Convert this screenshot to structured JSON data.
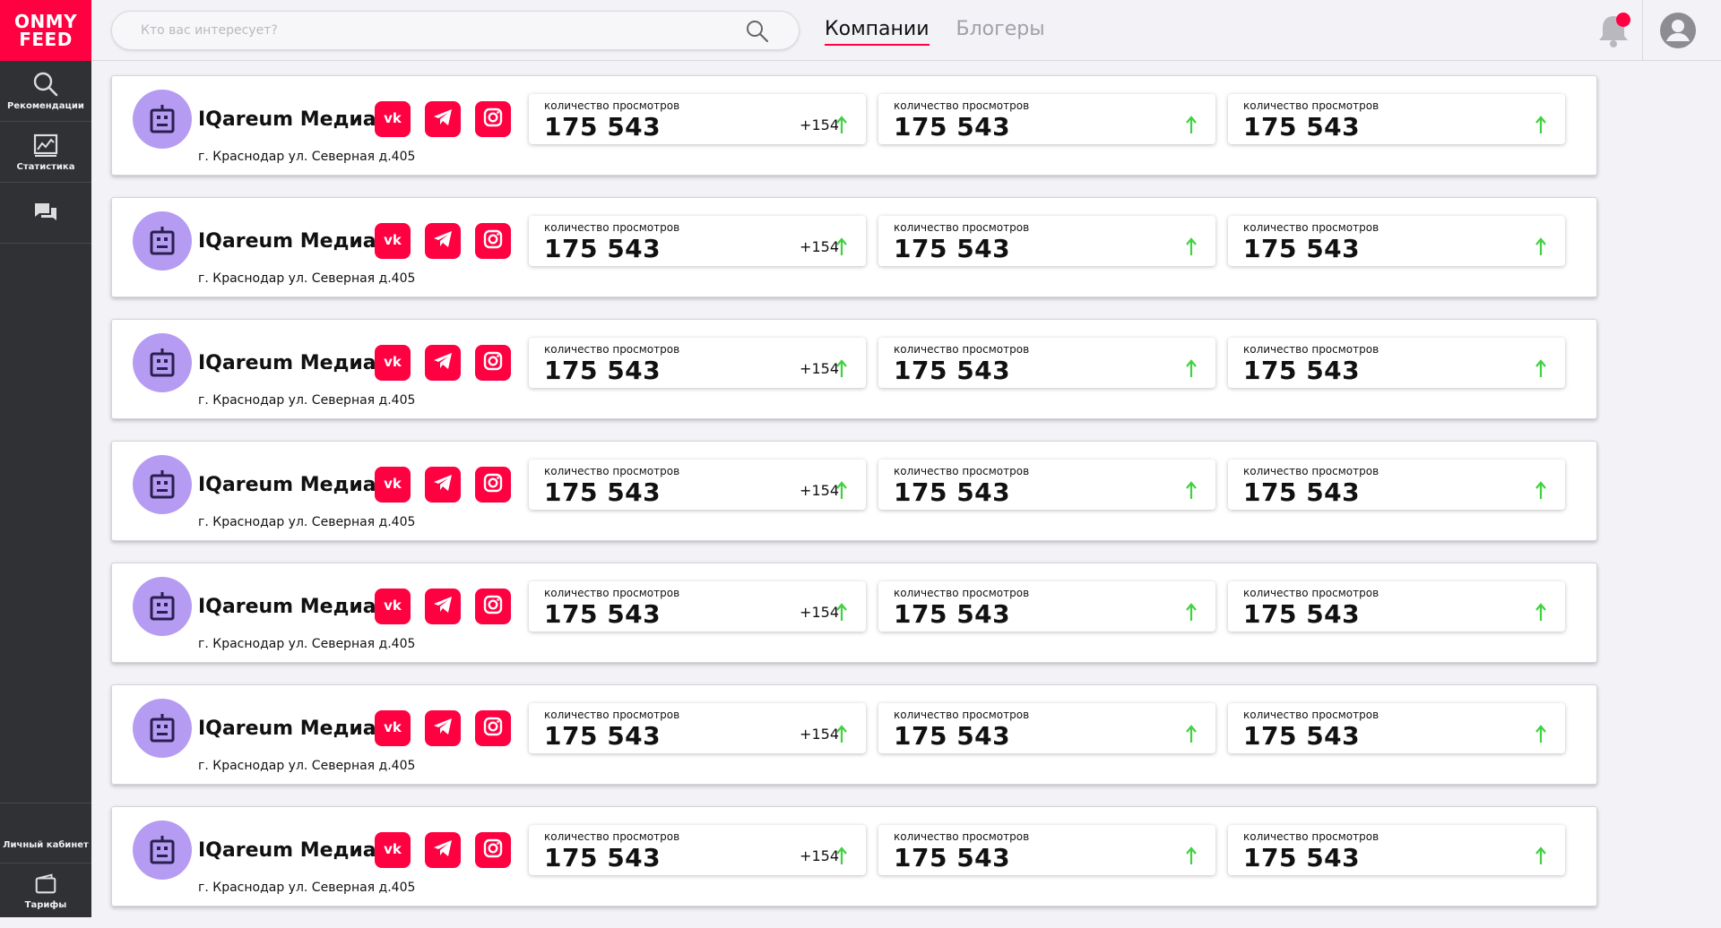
{
  "app": {
    "logo_line1": "ONMY",
    "logo_line2": "FEED"
  },
  "sidebar": {
    "items": [
      {
        "label": "Рекомендации",
        "icon": "search-icon"
      },
      {
        "label": "Статистика",
        "icon": "chart-icon"
      },
      {
        "label": "",
        "icon": "chat-icon"
      }
    ],
    "bottom": {
      "cabinet_label": "Личный кабинет",
      "tariffs_label": "Тарифы"
    }
  },
  "header": {
    "search_placeholder": "Кто вас интересует?",
    "tabs": [
      {
        "label": "Компании",
        "active": true
      },
      {
        "label": "Блогеры",
        "active": false
      }
    ],
    "notification_dot": true
  },
  "colors": {
    "accent": "#ff0040",
    "sidebar": "#2f3135",
    "avatar": "#b59cf2",
    "growth": "#3fd13f"
  },
  "companies": [
    {
      "name": "IQareum Медиа",
      "address": "г. Краснодар ул. Северная д.405",
      "socials": [
        "vk-icon",
        "telegram-icon",
        "instagram-icon"
      ],
      "stats": [
        {
          "caption": "количество просмотров",
          "value": "175 543",
          "delta": "+154"
        },
        {
          "caption": "количество просмотров",
          "value": "175 543",
          "delta": ""
        },
        {
          "caption": "количество просмотров",
          "value": "175 543",
          "delta": ""
        }
      ]
    },
    {
      "name": "IQareum Медиа",
      "address": "г. Краснодар ул. Северная д.405",
      "socials": [
        "vk-icon",
        "telegram-icon",
        "instagram-icon"
      ],
      "stats": [
        {
          "caption": "количество просмотров",
          "value": "175 543",
          "delta": "+154"
        },
        {
          "caption": "количество просмотров",
          "value": "175 543",
          "delta": ""
        },
        {
          "caption": "количество просмотров",
          "value": "175 543",
          "delta": ""
        }
      ]
    },
    {
      "name": "IQareum Медиа",
      "address": "г. Краснодар ул. Северная д.405",
      "socials": [
        "vk-icon",
        "telegram-icon",
        "instagram-icon"
      ],
      "stats": [
        {
          "caption": "количество просмотров",
          "value": "175 543",
          "delta": "+154"
        },
        {
          "caption": "количество просмотров",
          "value": "175 543",
          "delta": ""
        },
        {
          "caption": "количество просмотров",
          "value": "175 543",
          "delta": ""
        }
      ]
    },
    {
      "name": "IQareum Медиа",
      "address": "г. Краснодар ул. Северная д.405",
      "socials": [
        "vk-icon",
        "telegram-icon",
        "instagram-icon"
      ],
      "stats": [
        {
          "caption": "количество просмотров",
          "value": "175 543",
          "delta": "+154"
        },
        {
          "caption": "количество просмотров",
          "value": "175 543",
          "delta": ""
        },
        {
          "caption": "количество просмотров",
          "value": "175 543",
          "delta": ""
        }
      ]
    },
    {
      "name": "IQareum Медиа",
      "address": "г. Краснодар ул. Северная д.405",
      "socials": [
        "vk-icon",
        "telegram-icon",
        "instagram-icon"
      ],
      "stats": [
        {
          "caption": "количество просмотров",
          "value": "175 543",
          "delta": "+154"
        },
        {
          "caption": "количество просмотров",
          "value": "175 543",
          "delta": ""
        },
        {
          "caption": "количество просмотров",
          "value": "175 543",
          "delta": ""
        }
      ]
    },
    {
      "name": "IQareum Медиа",
      "address": "г. Краснодар ул. Северная д.405",
      "socials": [
        "vk-icon",
        "telegram-icon",
        "instagram-icon"
      ],
      "stats": [
        {
          "caption": "количество просмотров",
          "value": "175 543",
          "delta": "+154"
        },
        {
          "caption": "количество просмотров",
          "value": "175 543",
          "delta": ""
        },
        {
          "caption": "количество просмотров",
          "value": "175 543",
          "delta": ""
        }
      ]
    },
    {
      "name": "IQareum Медиа",
      "address": "г. Краснодар ул. Северная д.405",
      "socials": [
        "vk-icon",
        "telegram-icon",
        "instagram-icon"
      ],
      "stats": [
        {
          "caption": "количество просмотров",
          "value": "175 543",
          "delta": "+154"
        },
        {
          "caption": "количество просмотров",
          "value": "175 543",
          "delta": ""
        },
        {
          "caption": "количество просмотров",
          "value": "175 543",
          "delta": ""
        }
      ]
    }
  ]
}
